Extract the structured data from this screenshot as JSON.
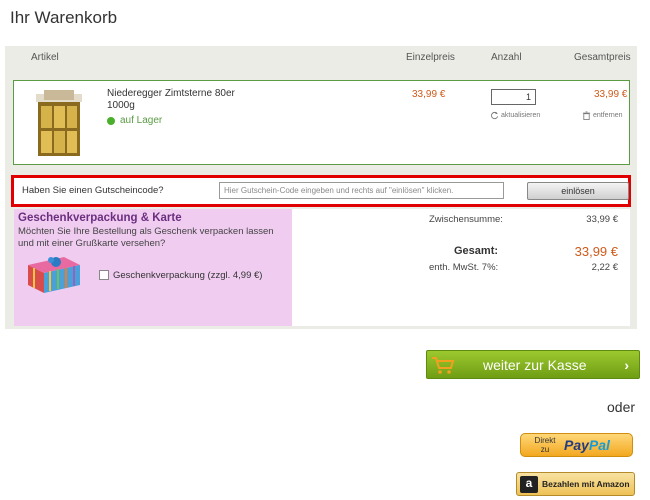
{
  "page": {
    "title": "Ihr Warenkorb"
  },
  "cart": {
    "headers": {
      "article": "Artikel",
      "unit_price": "Einzelpreis",
      "quantity": "Anzahl",
      "total_price": "Gesamtpreis"
    },
    "item": {
      "name": "Niederegger Zimtsterne 80er 1000g",
      "stock": "auf Lager",
      "unit_price": "33,99 €",
      "quantity": "1",
      "refresh_label": "aktualisieren",
      "total_price": "33,99 €",
      "remove_label": "entfernen"
    }
  },
  "coupon": {
    "label": "Haben Sie einen Gutscheincode?",
    "placeholder": "Hier Gutschein-Code eingeben und rechts auf \"einlösen\" klicken.",
    "button": "einlösen"
  },
  "gift": {
    "title": "Geschenkverpackung & Karte",
    "description": "Möchten Sie Ihre Bestellung als Geschenk verpacken lassen und mit einer Grußkarte versehen?",
    "checkbox_label": "Geschenkverpackung (zzgl. 4,99 €)"
  },
  "summary": {
    "subtotal_label": "Zwischensumme:",
    "subtotal_value": "33,99 €",
    "total_label": "Gesamt:",
    "total_value": "33,99 €",
    "vat_label": "enth. MwSt. 7%:",
    "vat_value": "2,22 €"
  },
  "checkout": {
    "label": "weiter zur Kasse",
    "icon": "cart-icon"
  },
  "alt_payments": {
    "or_label": "oder",
    "paypal_direct": "Direkt zu",
    "paypal_brand_pay": "Pay",
    "paypal_brand_pal": "Pal",
    "amazon_label": "Bezahlen mit Amazon",
    "amazon_glyph": "a"
  },
  "colors": {
    "price": "#d05a1a",
    "accent_green": "#6f9d14",
    "highlight_border": "#e00000",
    "gift_bg": "#f0cdf0"
  }
}
